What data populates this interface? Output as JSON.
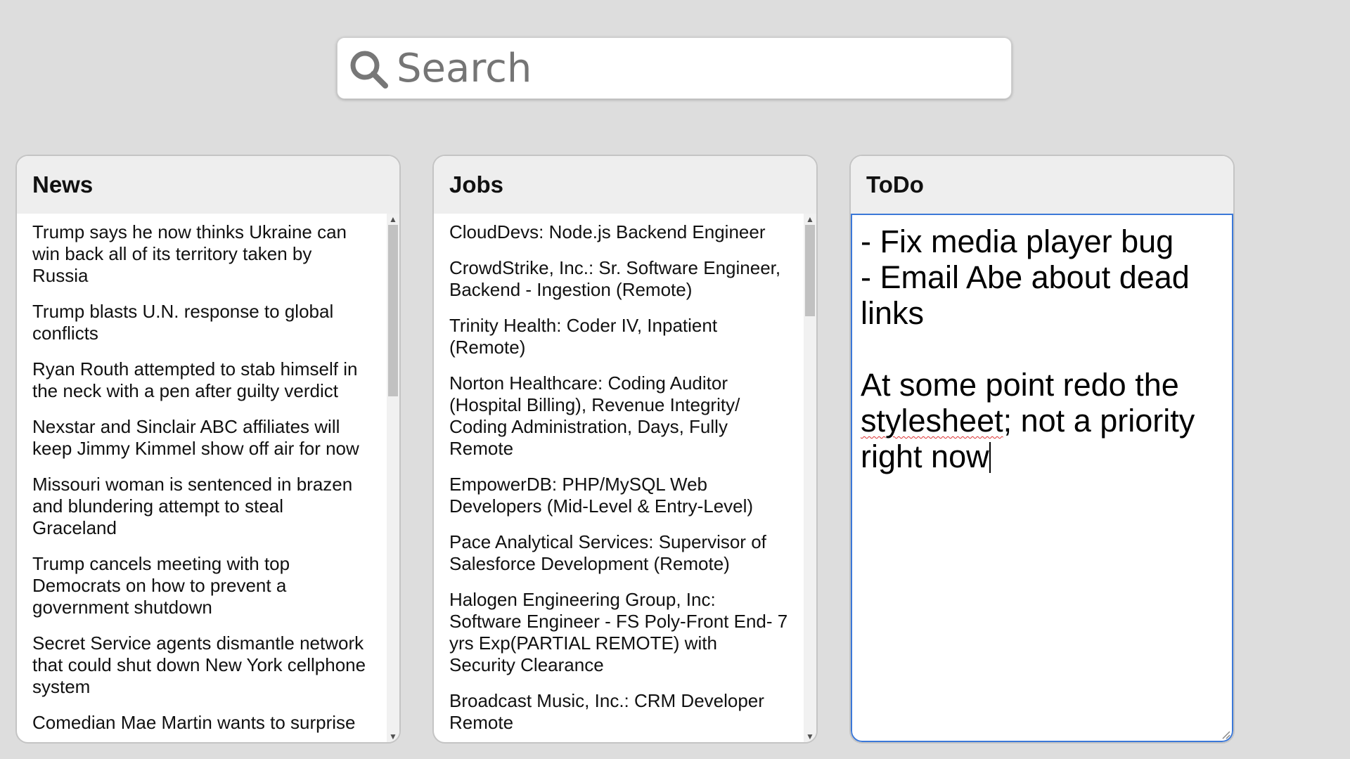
{
  "search": {
    "placeholder": "Search",
    "icon": "search-icon"
  },
  "news": {
    "title": "News",
    "items": [
      "Trump says he now thinks Ukraine can win back all of its territory taken by Russia",
      "Trump blasts U.N. response to global conflicts",
      "Ryan Routh attempted to stab himself in the neck with a pen after guilty verdict",
      "Nexstar and Sinclair ABC affiliates will keep Jimmy Kimmel show off air for now",
      "Missouri woman is sentenced in brazen and blundering attempt to steal Graceland",
      "Trump cancels meeting with top Democrats on how to prevent a government shutdown",
      "Secret Service agents dismantle network that could shut down New York cellphone system",
      "Comedian Mae Martin wants to surprise"
    ]
  },
  "jobs": {
    "title": "Jobs",
    "items": [
      "CloudDevs: Node.js Backend Engineer",
      "CrowdStrike, Inc.: Sr. Software Engineer, Backend - Ingestion (Remote)",
      "Trinity Health: Coder IV, Inpatient (Remote)",
      "Norton Healthcare: Coding Auditor (Hospital Billing), Revenue Integrity/ Coding Administration, Days, Fully Remote",
      "EmpowerDB: PHP/MySQL Web Developers (Mid-Level & Entry-Level)",
      "Pace Analytical Services: Supervisor of Salesforce Development (Remote)",
      "Halogen Engineering Group, Inc: Software Engineer - FS Poly-Front End- 7 yrs Exp(PARTIAL REMOTE) with Security Clearance",
      "Broadcast Music, Inc.: CRM Developer Remote"
    ]
  },
  "todo": {
    "title": "ToDo",
    "line1": "- Fix media player bug",
    "line2": "- Email Abe about dead links",
    "line3_before": "At some point redo the ",
    "line3_misspelled": "stylesheet",
    "line3_after": "; not a priority right now"
  },
  "colors": {
    "background": "#dddddd",
    "panel_header": "#eeeeee",
    "focus_border": "#3b78d8"
  }
}
